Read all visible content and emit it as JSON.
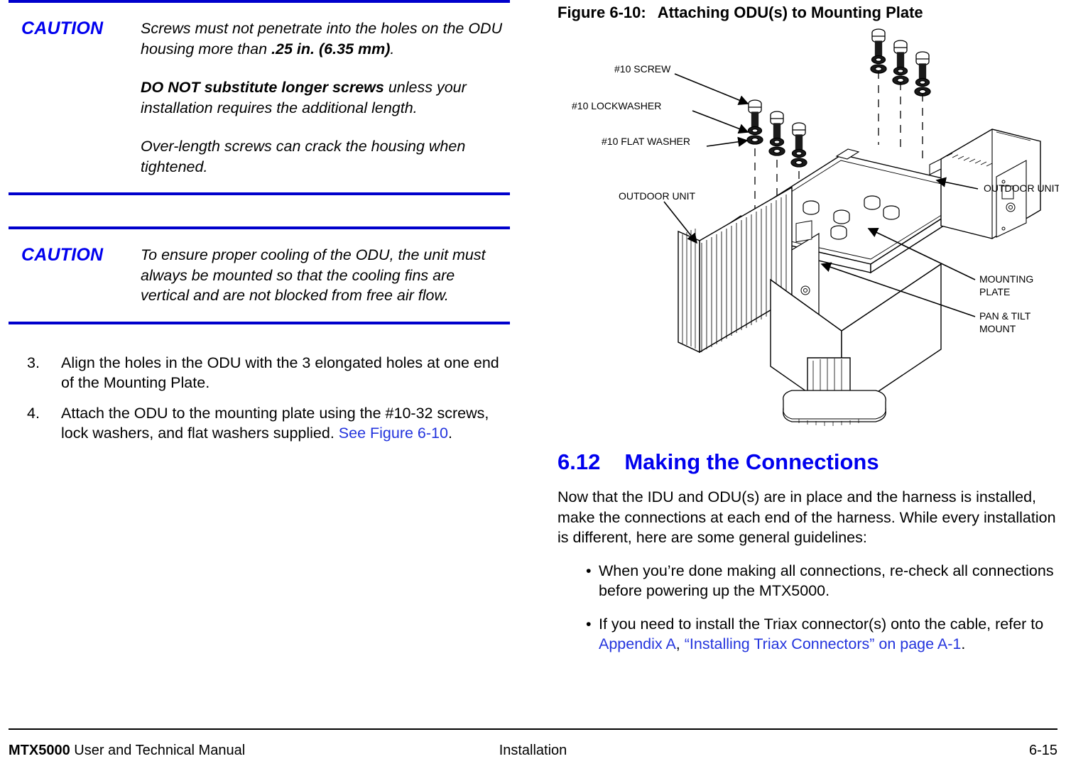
{
  "cautions": [
    {
      "label": "CAUTION",
      "paragraphs": [
        {
          "runs": [
            {
              "text": "Screws must not penetrate into the holes on the ODU housing more than ",
              "bold": false
            },
            {
              "text": ".25 in. (6.35 mm)",
              "bold": true
            },
            {
              "text": ".",
              "bold": false
            }
          ]
        },
        {
          "runs": [
            {
              "text": "DO NOT substitute longer screws",
              "bold": true
            },
            {
              "text": " unless your installation requires the additional length.",
              "bold": false
            }
          ]
        },
        {
          "runs": [
            {
              "text": "Over-length screws can crack the housing when tightened.",
              "bold": false
            }
          ]
        }
      ]
    },
    {
      "label": "CAUTION",
      "paragraphs": [
        {
          "runs": [
            {
              "text": "To ensure proper cooling of the ODU, the unit must always be mounted so that the cooling fins are vertical and are not blocked from free air flow.",
              "bold": false
            }
          ]
        }
      ]
    }
  ],
  "steps": [
    {
      "number": "3.",
      "runs": [
        {
          "text": "Align the holes in the ODU with the 3 elongated holes at one end of the Mounting Plate.",
          "link": false
        }
      ]
    },
    {
      "number": "4.",
      "runs": [
        {
          "text": "Attach the ODU to the mounting plate using the #10-32 screws, lock washers, and flat washers supplied.   ",
          "link": false
        },
        {
          "text": "See Figure 6-10",
          "link": true
        },
        {
          "text": ".",
          "link": false
        }
      ]
    }
  ],
  "figure": {
    "number": "Figure 6-10:",
    "title": "Attaching ODU(s) to Mounting Plate",
    "labels": {
      "screw": "#10 SCREW",
      "lockwasher": "#10 LOCKWASHER",
      "flat_washer": "#10 FLAT WASHER",
      "outdoor_unit_left": "OUTDOOR UNIT",
      "outdoor_unit_right": "OUTDOOR UNIT",
      "mounting_plate_line1": "MOUNTING",
      "mounting_plate_line2": "PLATE",
      "pan_tilt_line1": "PAN & TILT",
      "pan_tilt_line2": "MOUNT"
    }
  },
  "section": {
    "number": "6.12",
    "title": "Making the Connections",
    "intro": "Now that the IDU and ODU(s) are in place and the harness is installed, make the connections at each end of the harness. While every installation is different, here are some general guidelines:",
    "bullets": [
      {
        "marker": "•",
        "runs": [
          {
            "text": "When you’re done making all connections, re-check all connections before powering up the MTX5000.",
            "link": false
          }
        ]
      },
      {
        "marker": "•",
        "runs": [
          {
            "text": "If you need to install the Triax connector(s) onto the cable, refer to  ",
            "link": false
          },
          {
            "text": "Appendix A",
            "link": true
          },
          {
            "text": ", ",
            "link": false
          },
          {
            "text": "“Installing Triax Connectors” on page A-1",
            "link": true
          },
          {
            "text": ".",
            "link": false
          }
        ]
      }
    ]
  },
  "footer": {
    "manual_bold": "MTX5000",
    "manual_rest": " User and Technical Manual",
    "center": "Installation",
    "page": "6-15"
  },
  "colors": {
    "caution_blue": "#0000ee",
    "rule_blue": "#0000cc",
    "link_blue": "#2233dd",
    "text_black": "#000000"
  }
}
